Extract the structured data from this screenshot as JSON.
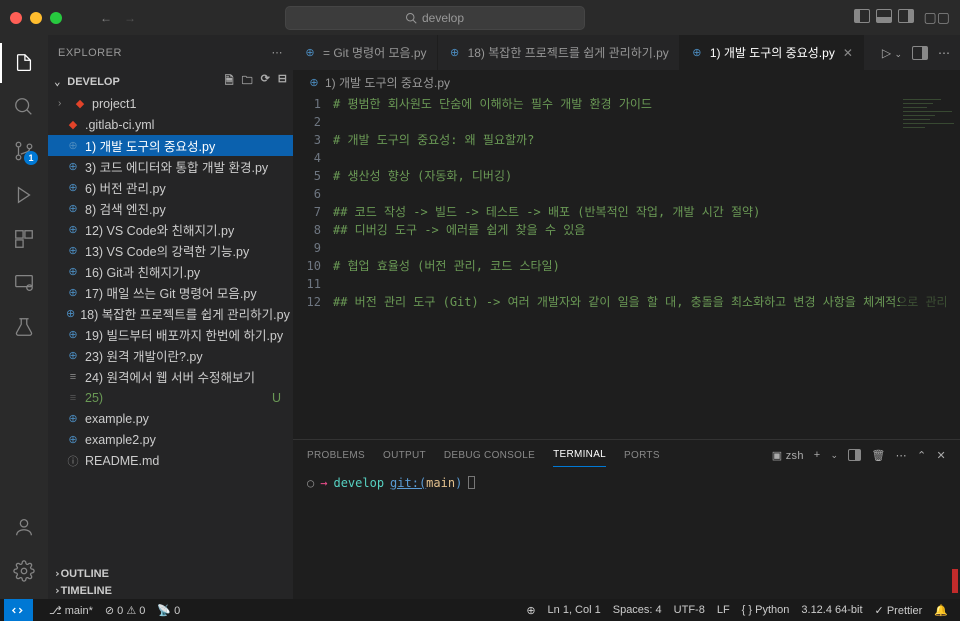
{
  "titlebar": {
    "search_placeholder": "develop"
  },
  "activity": {
    "scm_badge": "1"
  },
  "sidebar": {
    "title": "EXPLORER",
    "folder": "DEVELOP",
    "project": "project1",
    "outline": "OUTLINE",
    "timeline": "TIMELINE",
    "files": [
      {
        "label": ".gitlab-ci.yml",
        "type": "gitlab"
      },
      {
        "label": "1) 개발 도구의 중요성.py",
        "type": "py",
        "selected": true
      },
      {
        "label": "3) 코드 에디터와 통합 개발 환경.py",
        "type": "py"
      },
      {
        "label": "6) 버전 관리.py",
        "type": "py"
      },
      {
        "label": "8) 검색 엔진.py",
        "type": "py"
      },
      {
        "label": "12) VS Code와 친해지기.py",
        "type": "py"
      },
      {
        "label": "13) VS Code의 강력한 기능.py",
        "type": "py"
      },
      {
        "label": "16) Git과 친해지기.py",
        "type": "py"
      },
      {
        "label": "17) 매일 쓰는 Git 명령어 모음.py",
        "type": "py"
      },
      {
        "label": "18) 복잡한 프로젝트를 쉽게 관리하기.py",
        "type": "py"
      },
      {
        "label": "19) 빌드부터 배포까지 한번에 하기.py",
        "type": "py"
      },
      {
        "label": "23) 원격 개발이란?.py",
        "type": "py"
      },
      {
        "label": "24) 원격에서 웹 서버 수정해보기",
        "type": "md-ish"
      },
      {
        "label": "25)",
        "type": "none",
        "status": "U"
      },
      {
        "label": "example.py",
        "type": "py"
      },
      {
        "label": "example2.py",
        "type": "py"
      },
      {
        "label": "README.md",
        "type": "md"
      }
    ]
  },
  "tabs": {
    "items": [
      {
        "label": "= Git 명령어 모음.py",
        "icon": "py"
      },
      {
        "label": "18) 복잡한 프로젝트를 쉽게 관리하기.py",
        "icon": "py"
      },
      {
        "label": "1) 개발 도구의 중요성.py",
        "icon": "py",
        "active": true
      }
    ]
  },
  "breadcrumb": {
    "file": "1) 개발 도구의 중요성.py"
  },
  "editor": {
    "lines": [
      "# 평범한 회사원도 단숨에 이해하는 필수 개발 환경 가이드",
      "",
      "# 개발 도구의 중요성: 왜 필요할까?",
      "",
      "# 생산성 향상 (자동화, 디버깅)",
      "",
      "## 코드 작성 -> 빌드 -> 테스트 -> 배포 (반복적인 작업, 개발 시간 절약)",
      "## 디버깅 도구 -> 에러를 쉽게 찾을 수 있음",
      "",
      "# 협업 효율성 (버전 관리, 코드 스타일)",
      "",
      "## 버전 관리 도구 (Git) -> 여러 개발자와 같이 일을 할 대, 충돌을 최소화하고 변경 사항을 체계적으로 관리"
    ]
  },
  "panel": {
    "tabs": {
      "problems": "PROBLEMS",
      "output": "OUTPUT",
      "debug": "DEBUG CONSOLE",
      "terminal": "TERMINAL",
      "ports": "PORTS"
    },
    "terminal_shell": "zsh",
    "terminal": {
      "prefix": "→",
      "cwd": "develop",
      "git_pre": "git:(",
      "git_branch": "main",
      "git_suf": ")"
    }
  },
  "statusbar": {
    "branch": "main*",
    "errors": "0",
    "warnings": "0",
    "ports": "0",
    "cursor": "Ln 1, Col 1",
    "spaces": "Spaces: 4",
    "encoding": "UTF-8",
    "eol": "LF",
    "lang": "{ } Python",
    "interpreter": "3.12.4 64-bit",
    "prettier": "Prettier"
  }
}
